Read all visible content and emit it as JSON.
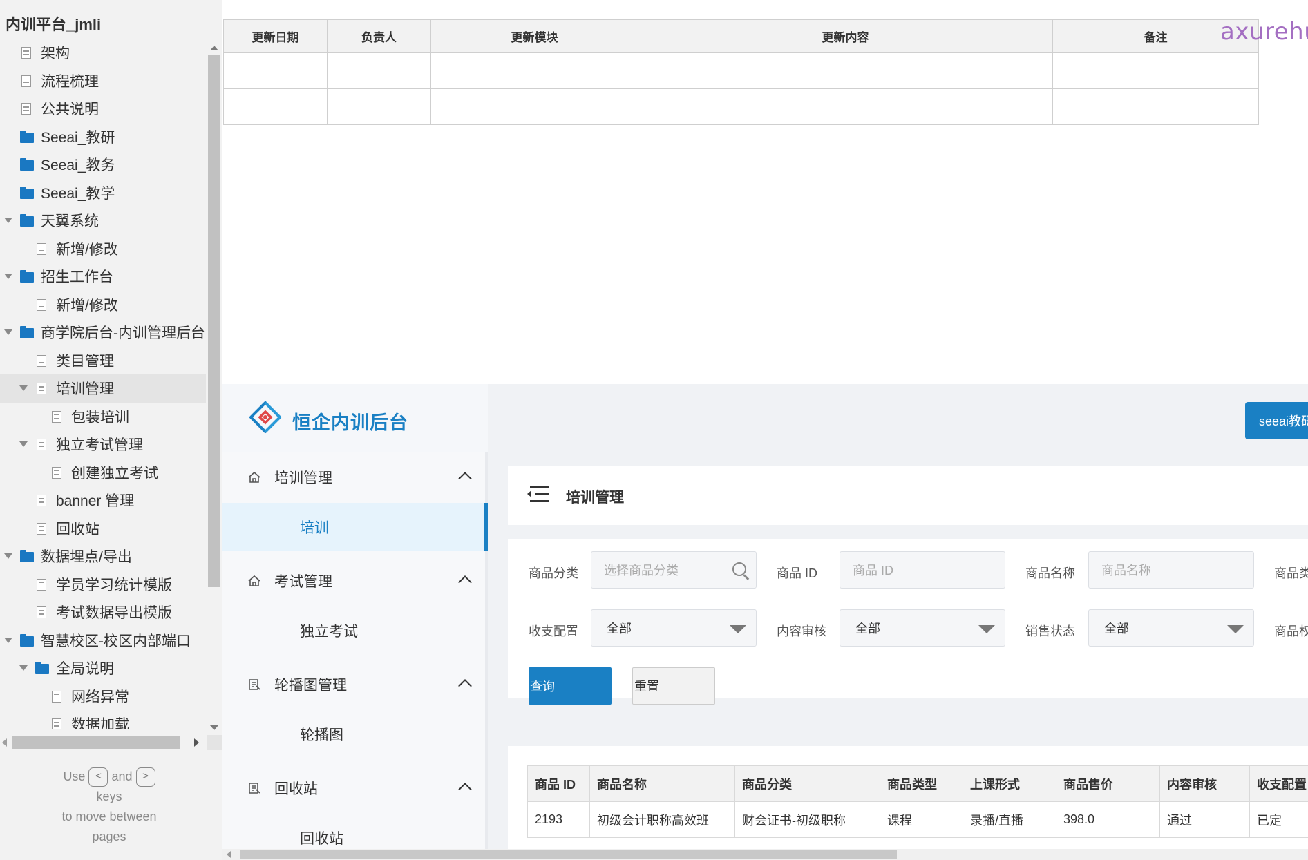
{
  "sitemap": {
    "title": "内训平台_jmli",
    "items": [
      {
        "label": "架构",
        "type": "page",
        "level": 0,
        "expand": "none"
      },
      {
        "label": "流程梳理",
        "type": "page",
        "level": 0,
        "expand": "none"
      },
      {
        "label": "公共说明",
        "type": "page",
        "level": 0,
        "expand": "none"
      },
      {
        "label": "Seeai_教研",
        "type": "folder",
        "level": 0,
        "expand": "none"
      },
      {
        "label": "Seeai_教务",
        "type": "folder",
        "level": 0,
        "expand": "none"
      },
      {
        "label": "Seeai_教学",
        "type": "folder",
        "level": 0,
        "expand": "none"
      },
      {
        "label": "天翼系统",
        "type": "folder",
        "level": 0,
        "expand": "open"
      },
      {
        "label": "新增/修改",
        "type": "page",
        "level": 1,
        "expand": "none"
      },
      {
        "label": "招生工作台",
        "type": "folder",
        "level": 0,
        "expand": "open"
      },
      {
        "label": "新增/修改",
        "type": "page",
        "level": 1,
        "expand": "none"
      },
      {
        "label": "商学院后台-内训管理后台",
        "type": "folder",
        "level": 0,
        "expand": "open"
      },
      {
        "label": "类目管理",
        "type": "page",
        "level": 1,
        "expand": "none"
      },
      {
        "label": "培训管理",
        "type": "page",
        "level": 1,
        "expand": "open",
        "selected": true
      },
      {
        "label": "包装培训",
        "type": "page",
        "level": 2,
        "expand": "none"
      },
      {
        "label": "独立考试管理",
        "type": "page",
        "level": 1,
        "expand": "open"
      },
      {
        "label": "创建独立考试",
        "type": "page",
        "level": 2,
        "expand": "none"
      },
      {
        "label": "banner 管理",
        "type": "page",
        "level": 1,
        "expand": "none"
      },
      {
        "label": "回收站",
        "type": "page",
        "level": 1,
        "expand": "none"
      },
      {
        "label": "数据埋点/导出",
        "type": "folder",
        "level": 0,
        "expand": "open"
      },
      {
        "label": "学员学习统计模版",
        "type": "page",
        "level": 1,
        "expand": "none"
      },
      {
        "label": "考试数据导出模版",
        "type": "page",
        "level": 1,
        "expand": "none"
      },
      {
        "label": "智慧校区-校区内部端口",
        "type": "folder",
        "level": 0,
        "expand": "open"
      },
      {
        "label": "全局说明",
        "type": "folder",
        "level": 1,
        "expand": "open"
      },
      {
        "label": "网络异常",
        "type": "page",
        "level": 2,
        "expand": "none"
      },
      {
        "label": "数据加载",
        "type": "page",
        "level": 2,
        "expand": "none"
      }
    ],
    "hint": {
      "use": "Use",
      "and": "and",
      "keys": "keys",
      "to_move": "to move between",
      "pages": "pages",
      "key_prev": "<",
      "key_next": ">"
    }
  },
  "watermark": "axurehub.com 原型资源站",
  "changelog": {
    "headers": [
      "更新日期",
      "负责人",
      "更新模块",
      "更新内容",
      "备注"
    ],
    "rows": [
      [
        "",
        "",
        "",
        "",
        ""
      ],
      [
        "",
        "",
        "",
        "",
        ""
      ]
    ]
  },
  "app": {
    "logo_text": "恒企内训后台",
    "top_button": "seeai教研",
    "nav": [
      {
        "group": "培训管理",
        "icon": "home-icon",
        "items": [
          {
            "label": "培训",
            "active": true
          }
        ]
      },
      {
        "group": "考试管理",
        "icon": "home-icon",
        "items": [
          {
            "label": "独立考试",
            "active": false
          }
        ]
      },
      {
        "group": "轮播图管理",
        "icon": "carousel-icon",
        "items": [
          {
            "label": "轮播图",
            "active": false
          }
        ]
      },
      {
        "group": "回收站",
        "icon": "recycle-icon",
        "items": [
          {
            "label": "回收站",
            "active": false
          }
        ]
      }
    ],
    "page_title": "培训管理",
    "filters": {
      "category_label": "商品分类",
      "category_placeholder": "选择商品分类",
      "id_label": "商品 ID",
      "id_placeholder": "商品 ID",
      "name_label": "商品名称",
      "name_placeholder": "商品名称",
      "type_label": "商品类",
      "payment_label": "收支配置",
      "payment_value": "全部",
      "review_label": "内容审核",
      "review_value": "全部",
      "sale_label": "销售状态",
      "sale_value": "全部",
      "extra_label": "商品权",
      "query": "查询",
      "reset": "重置"
    },
    "table": {
      "headers": [
        "商品 ID",
        "商品名称",
        "商品分类",
        "商品类型",
        "上课形式",
        "商品售价",
        "内容审核",
        "收支配置"
      ],
      "rows": [
        [
          "2193",
          "初级会计职称高效班",
          "财会证书-初级职称",
          "课程",
          "录播/直播",
          "398.0",
          "通过",
          "已定"
        ]
      ]
    }
  }
}
